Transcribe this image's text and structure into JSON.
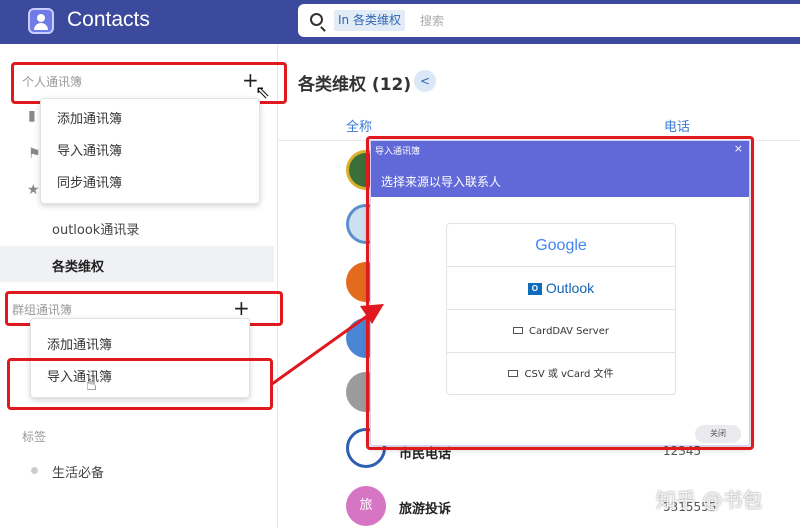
{
  "app": {
    "title": "Contacts"
  },
  "search": {
    "scope": "In 各类维权",
    "placeholder": "搜索"
  },
  "sidebar": {
    "personal_header": "个人通讯簿",
    "personal_menu": [
      "添加通讯簿",
      "导入通讯簿",
      "同步通讯簿"
    ],
    "books": [
      "outlook通讯录",
      "各类维权"
    ],
    "group_header": "群组通讯簿",
    "group_menu": [
      "添加通讯簿",
      "导入通讯簿"
    ],
    "tags_header": "标签",
    "tags": [
      "生活必备"
    ]
  },
  "main": {
    "title": "各类维权 (12)",
    "columns": [
      "全称",
      "电话"
    ],
    "rows": [
      {
        "name": "市民电话",
        "phone": "12345"
      },
      {
        "name": "旅游投诉",
        "phone": "5315555",
        "avatar_text": "旅"
      }
    ]
  },
  "dialog": {
    "title": "导入通讯簿",
    "subtitle": "选择来源以导入联系人",
    "options": [
      "Google",
      "Outlook",
      "CardDAV Server",
      "CSV 或 vCard 文件"
    ],
    "close_label": "关闭"
  },
  "watermark": "知乎 @书包",
  "colors": {
    "header": "#3b4a9c",
    "dialog_header": "#6169d9",
    "annotation": "#e0191f",
    "accent": "#3a7bd5"
  }
}
